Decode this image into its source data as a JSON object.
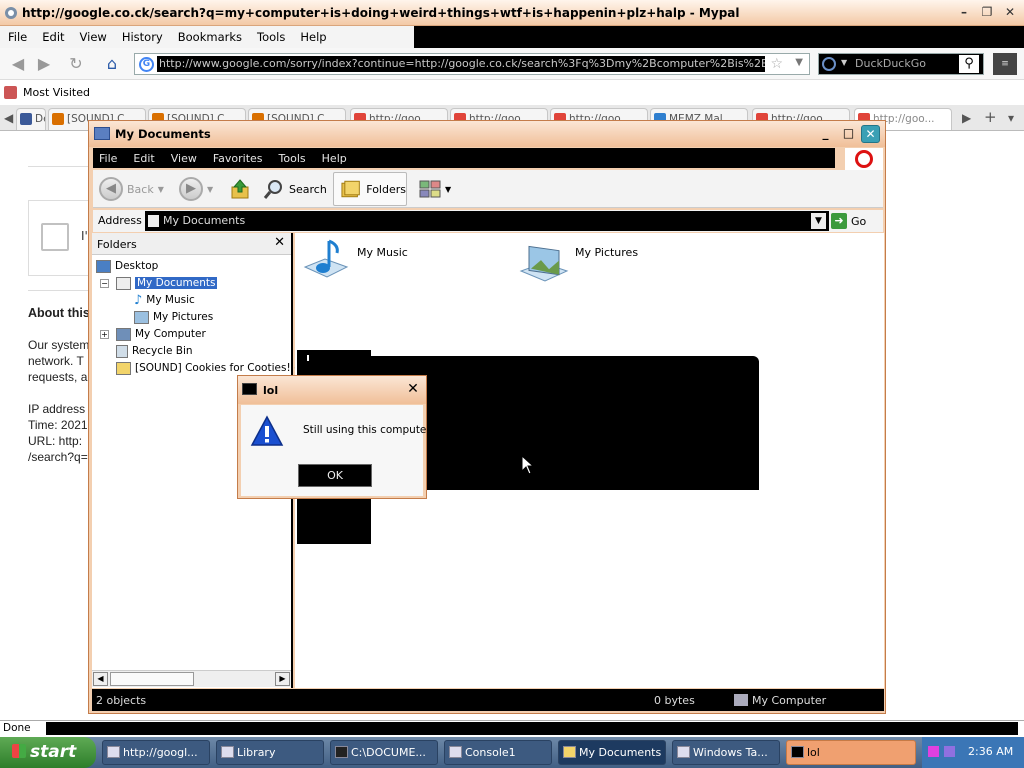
{
  "browser": {
    "title": "http://google.co.ck/search?q=my+computer+is+doing+weird+things+wtf+is+happenin+plz+halp - Mypal",
    "menu": [
      "File",
      "Edit",
      "View",
      "History",
      "Bookmarks",
      "Tools",
      "Help"
    ],
    "url": "http://www.google.com/sorry/index?continue=http://google.co.ck/search%3Fq%3Dmy%2Bcomputer%2Bis%2Bdoing%2Bweird",
    "search_engine": "DuckDuckGo",
    "bookmark": "Most Visited",
    "tabs": [
      {
        "label": "De...",
        "color": "#3b5998"
      },
      {
        "label": "[SOUND] C...",
        "color": "#d96f00"
      },
      {
        "label": "[SOUND] C...",
        "color": "#d96f00"
      },
      {
        "label": "[SOUND] C...",
        "color": "#d96f00"
      },
      {
        "label": "http://goo...",
        "color": "#e0443a"
      },
      {
        "label": "http://goo...",
        "color": "#e0443a"
      },
      {
        "label": "http://goo...",
        "color": "#e0443a"
      },
      {
        "label": "MEMZ Mal...",
        "color": "#2f7fcf"
      },
      {
        "label": "http://goo...",
        "color": "#e0443a"
      },
      {
        "label": "http://goo...",
        "color": "#e0443a"
      }
    ],
    "status": "Done"
  },
  "webpage": {
    "captcha_text": "I'",
    "about_heading": "About this",
    "paragraph": [
      "Our system",
      "network. T",
      "requests, a"
    ],
    "info": [
      "IP address",
      "Time: 2021",
      "URL: http:",
      "/search?q="
    ]
  },
  "explorer": {
    "title": "My Documents",
    "menu": [
      "File",
      "Edit",
      "View",
      "Favorites",
      "Tools",
      "Help"
    ],
    "toolbar": {
      "back": "Back",
      "search": "Search",
      "folders": "Folders"
    },
    "address_label": "Address",
    "address_value": "My Documents",
    "go_label": "Go",
    "tree_header": "Folders",
    "tree": {
      "desktop": "Desktop",
      "my_documents": "My Documents",
      "my_music": "My Music",
      "my_pictures": "My Pictures",
      "my_computer": "My Computer",
      "recycle_bin": "Recycle Bin",
      "sound_folder": "[SOUND] Cookies for Cooties! (@"
    },
    "content": {
      "item1": "My Music",
      "item2": "My Pictures"
    },
    "status": {
      "objects": "2 objects",
      "size": "0 bytes",
      "location": "My Computer"
    }
  },
  "dialog": {
    "title": "lol",
    "message": "Still using this computer?",
    "ok": "OK"
  },
  "taskbar": {
    "start": "start",
    "tasks": [
      "http://googl...",
      "Library",
      "C:\\DOCUME...",
      "Console1",
      "My Documents",
      "Windows Ta...",
      "lol"
    ],
    "clock": "2:36 AM"
  }
}
